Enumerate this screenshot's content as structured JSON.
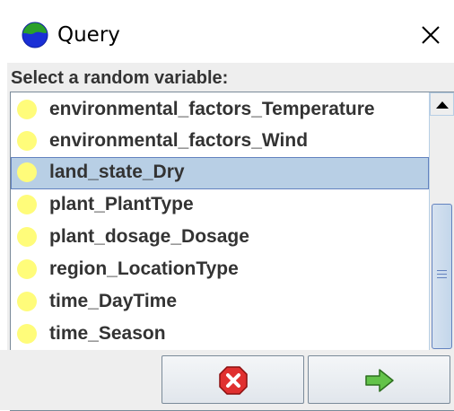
{
  "window": {
    "title": "Query",
    "icon": "globe-icon",
    "close_icon": "close-icon"
  },
  "prompt": "Select a random variable:",
  "variables": {
    "items": [
      {
        "label": "environmental_factors_Temperature",
        "icon": "yellow-bulb-icon",
        "selected": false
      },
      {
        "label": "environmental_factors_Wind",
        "icon": "yellow-bulb-icon",
        "selected": false
      },
      {
        "label": "land_state_Dry",
        "icon": "yellow-bulb-icon",
        "selected": true
      },
      {
        "label": "plant_PlantType",
        "icon": "yellow-bulb-icon",
        "selected": false
      },
      {
        "label": "plant_dosage_Dosage",
        "icon": "yellow-bulb-icon",
        "selected": false
      },
      {
        "label": "region_LocationType",
        "icon": "yellow-bulb-icon",
        "selected": false
      },
      {
        "label": "time_DayTime",
        "icon": "yellow-bulb-icon",
        "selected": false
      },
      {
        "label": "time_Season",
        "icon": "yellow-bulb-icon",
        "selected": false
      }
    ]
  },
  "buttons": {
    "cancel_icon": "red-x-circle-icon",
    "ok_icon": "green-arrow-right-icon"
  },
  "colors": {
    "selection": "#b8cfe5",
    "bulb": "#fffc7a",
    "cancel": "#e03030",
    "ok": "#4caf3a"
  }
}
